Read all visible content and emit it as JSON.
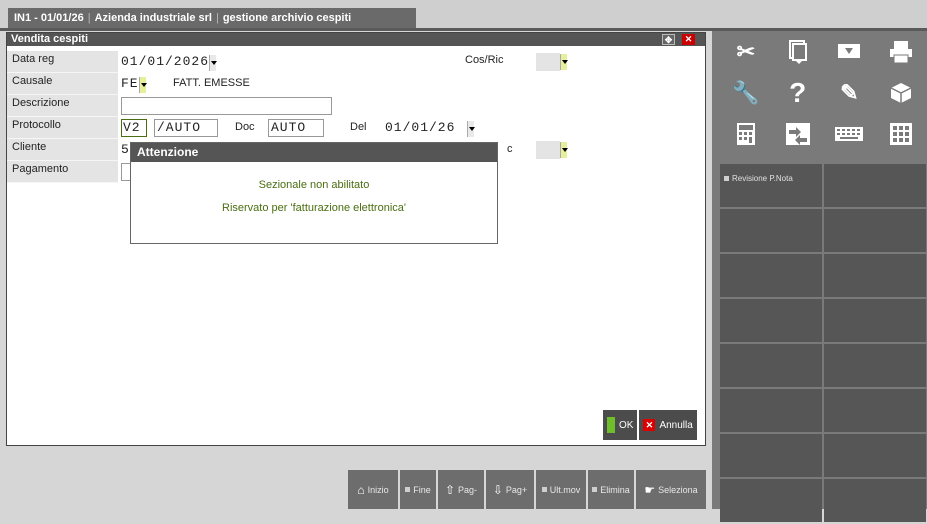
{
  "tabbar": {
    "code": "IN1 - 01/01/26",
    "company": "Azienda industriale srl",
    "module": "gestione archivio cespiti"
  },
  "window": {
    "title": "Vendita cespiti",
    "fields": {
      "data_reg_label": "Data reg",
      "data_reg_value": "01/01/2026",
      "cos_ric_label": "Cos/Ric",
      "causale_label": "Causale",
      "causale_value": "FE",
      "causale_desc": "FATT. EMESSE",
      "descrizione_label": "Descrizione",
      "protocollo_label": "Protocollo",
      "protocollo_sezionale": "V2",
      "protocollo_numero": "/AUTO",
      "doc_label": "Doc",
      "doc_value": "AUTO",
      "del_label": "Del",
      "del_value": "01/01/26",
      "cliente_label": "Cliente",
      "cliente_value": "5",
      "cliente_right_label": "c",
      "pagamento_label": "Pagamento"
    }
  },
  "dialog": {
    "title": "Attenzione",
    "line1": "Sezionale non abilitato",
    "line2": "Riservato per 'fatturazione elettronica'"
  },
  "buttons": {
    "ok": "OK",
    "annulla": "Annulla"
  },
  "bottom_bar": {
    "inizio": "Inizio",
    "fine": "Fine",
    "pag_prev": "Pag-",
    "pag_next": "Pag+",
    "ult_mov": "Ult.mov",
    "elimina": "Elimina",
    "seleziona": "Seleziona"
  },
  "side_panel": {
    "revisione": "Revisione P.Nota"
  }
}
